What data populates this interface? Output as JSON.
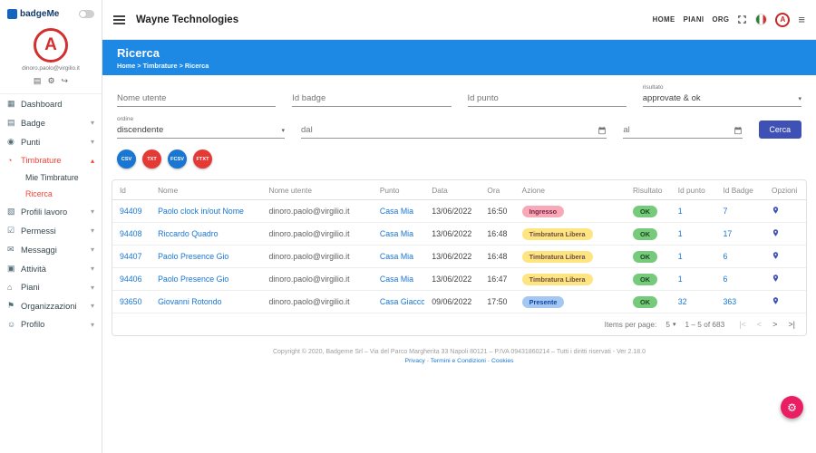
{
  "app": {
    "logo_text": "badgeMe",
    "avatar_letter": "A",
    "email": "dinoro.paolo@virgilio.it"
  },
  "topbar": {
    "title": "Wayne Technologies",
    "links": [
      "HOME",
      "PIANI",
      "ORG"
    ]
  },
  "sidebar": {
    "items": [
      {
        "label": "Dashboard",
        "icon": "dashboard",
        "expandable": false
      },
      {
        "label": "Badge",
        "icon": "badge",
        "expandable": true
      },
      {
        "label": "Punti",
        "icon": "location",
        "expandable": true
      },
      {
        "label": "Timbrature",
        "icon": "clock",
        "expandable": true,
        "expanded": true,
        "active": true,
        "children": [
          {
            "label": "Mie Timbrature",
            "active": false
          },
          {
            "label": "Ricerca",
            "active": true
          }
        ]
      },
      {
        "label": "Profili lavoro",
        "icon": "work",
        "expandable": true
      },
      {
        "label": "Permessi",
        "icon": "thumb",
        "expandable": true
      },
      {
        "label": "Messaggi",
        "icon": "mail",
        "expandable": true
      },
      {
        "label": "Attività",
        "icon": "tasks",
        "expandable": true
      },
      {
        "label": "Piani",
        "icon": "bank",
        "expandable": true
      },
      {
        "label": "Organizzazioni",
        "icon": "flag",
        "expandable": true
      },
      {
        "label": "Profilo",
        "icon": "person",
        "expandable": true
      }
    ]
  },
  "header": {
    "title": "Ricerca",
    "breadcrumb": "Home > Timbrature > Ricerca"
  },
  "filters": {
    "nome_utente_placeholder": "Nome utente",
    "id_badge_placeholder": "Id badge",
    "id_punto_placeholder": "Id punto",
    "risultato_label": "risultato",
    "risultato_value": "approvate & ok",
    "ordine_label": "ordine",
    "ordine_value": "discendente",
    "dal_placeholder": "dal",
    "al_placeholder": "al",
    "cerca_label": "Cerca",
    "exports": [
      {
        "label": "CSV",
        "color": "#1976d2"
      },
      {
        "label": "TXT",
        "color": "#e53935"
      },
      {
        "label": "FCSV",
        "color": "#1976d2"
      },
      {
        "label": "FTXT",
        "color": "#e53935"
      }
    ]
  },
  "table": {
    "columns": [
      "Id",
      "Nome",
      "Nome utente",
      "Punto",
      "Data",
      "Ora",
      "Azione",
      "Risultato",
      "Id punto",
      "Id Badge",
      "Opzioni"
    ],
    "rows": [
      {
        "id": "94409",
        "nome": "Paolo clock in/out Nome",
        "nome_utente": "dinoro.paolo@virgilio.it",
        "punto": "Casa Mia",
        "data": "13/06/2022",
        "ora": "16:50",
        "azione": "Ingresso",
        "azione_type": "ingresso",
        "risultato": "OK",
        "id_punto": "1",
        "id_badge": "7"
      },
      {
        "id": "94408",
        "nome": "Riccardo Quadro",
        "nome_utente": "dinoro.paolo@virgilio.it",
        "punto": "Casa Mia",
        "data": "13/06/2022",
        "ora": "16:48",
        "azione": "Timbratura Libera",
        "azione_type": "libera",
        "risultato": "OK",
        "id_punto": "1",
        "id_badge": "17"
      },
      {
        "id": "94407",
        "nome": "Paolo Presence Gio",
        "nome_utente": "dinoro.paolo@virgilio.it",
        "punto": "Casa Mia",
        "data": "13/06/2022",
        "ora": "16:48",
        "azione": "Timbratura Libera",
        "azione_type": "libera",
        "risultato": "OK",
        "id_punto": "1",
        "id_badge": "6"
      },
      {
        "id": "94406",
        "nome": "Paolo Presence Gio",
        "nome_utente": "dinoro.paolo@virgilio.it",
        "punto": "Casa Mia",
        "data": "13/06/2022",
        "ora": "16:47",
        "azione": "Timbratura Libera",
        "azione_type": "libera",
        "risultato": "OK",
        "id_punto": "1",
        "id_badge": "6"
      },
      {
        "id": "93650",
        "nome": "Giovanni Rotondo",
        "nome_utente": "dinoro.paolo@virgilio.it",
        "punto": "Casa Giacco",
        "data": "09/06/2022",
        "ora": "17:50",
        "azione": "Presente",
        "azione_type": "presente",
        "risultato": "OK",
        "id_punto": "32",
        "id_badge": "363"
      }
    ]
  },
  "pagination": {
    "items_label": "Items per page:",
    "per_page": "5",
    "range": "1 – 5 of 683"
  },
  "footer": {
    "copyright": "Copyright © 2020, Badgeme Srl  – Via del Parco Margherita 33 Napoli 80121 – P.IVA 09431860214 – Tutti i diritti riservati  -  Ver 2.18.0",
    "links": [
      "Privacy",
      "Termini e Condizioni",
      "Cookies"
    ]
  },
  "colors": {
    "header_blue": "#1e88e5",
    "active_red": "#f44336",
    "link_blue": "#1976d2",
    "cerca_button": "#3f51b5",
    "fab_pink": "#e91e63",
    "chip_ok": "#77c97c",
    "chip_ingresso": "#f8a9b8",
    "chip_libera": "#ffe582",
    "chip_presente": "#a5c8f2"
  }
}
